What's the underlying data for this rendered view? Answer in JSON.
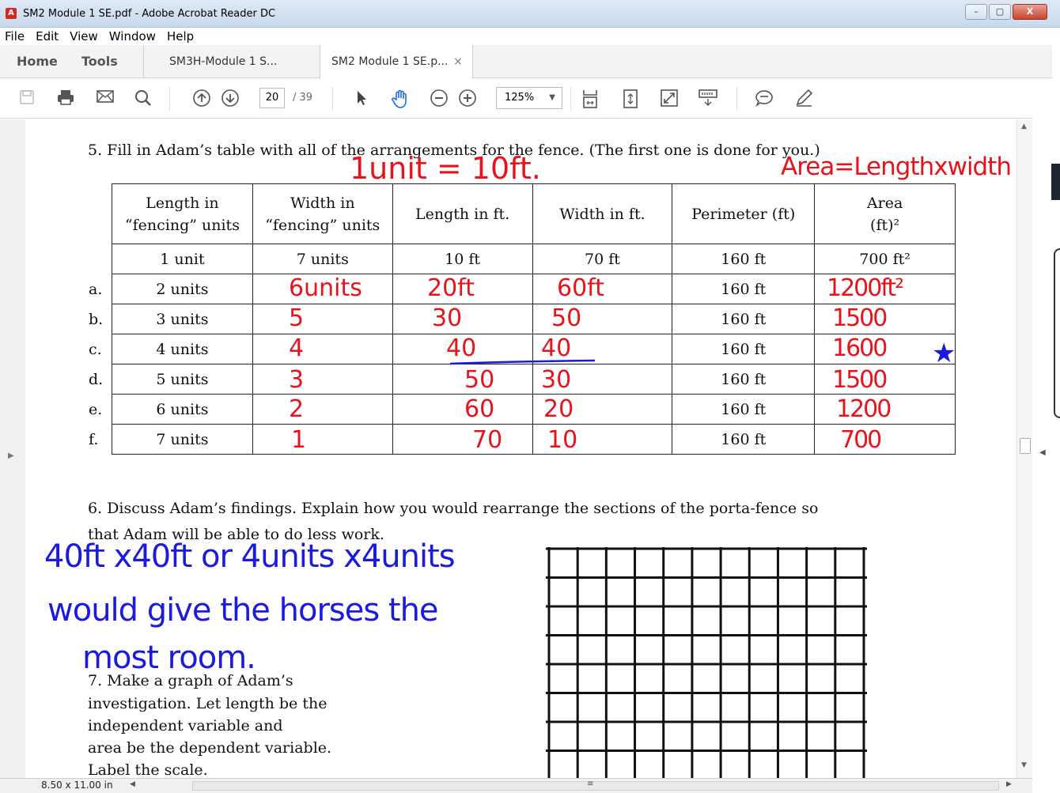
{
  "window": {
    "title": "SM2 Module 1 SE.pdf - Adobe Acrobat Reader DC",
    "controls": {
      "minimize": "–",
      "maximize": "▢",
      "close": "X"
    }
  },
  "menu": [
    "File",
    "Edit",
    "View",
    "Window",
    "Help"
  ],
  "tabs": {
    "home": "Home",
    "tools": "Tools",
    "documents": [
      {
        "label": "SM3H-Module 1 S..."
      },
      {
        "label": "SM2 Module 1 SE.p...",
        "close": "×"
      }
    ]
  },
  "toolbar": {
    "page_current": "20",
    "page_total": "/ 39",
    "zoom": "125%",
    "icons": [
      "save-icon",
      "print-icon",
      "email-icon",
      "search-icon",
      "page-up-icon",
      "page-down-icon",
      "select-arrow-icon",
      "hand-icon",
      "zoom-out-icon",
      "zoom-in-icon",
      "fit-page-icon",
      "scroll-mode-icon",
      "full-screen-icon",
      "read-mode-icon",
      "comment-icon",
      "sign-icon"
    ]
  },
  "document": {
    "q5": "5.  Fill in Adam’s table with all of the arrangements for the fence.  (The first one is done for you.)",
    "table": {
      "headers": [
        "Length in\n“fencing” units",
        "Width in\n“fencing” units",
        "Length in ft.",
        "Width in ft.",
        "Perimeter (ft)",
        "Area\n(ft)²"
      ],
      "example_row": [
        "1 unit",
        "7 units",
        "10 ft",
        "70 ft",
        "160 ft",
        "700 ft²"
      ],
      "rows": [
        {
          "label": "a.",
          "length_units": "2 units",
          "perimeter": "160 ft"
        },
        {
          "label": "b.",
          "length_units": "3 units",
          "perimeter": "160 ft"
        },
        {
          "label": "c.",
          "length_units": "4 units",
          "perimeter": "160 ft"
        },
        {
          "label": "d.",
          "length_units": "5 units",
          "perimeter": "160 ft"
        },
        {
          "label": "e.",
          "length_units": "6 units",
          "perimeter": "160 ft"
        },
        {
          "label": "f.",
          "length_units": "7 units",
          "perimeter": "160 ft"
        }
      ]
    },
    "q6_line1": "6.  Discuss Adam’s findings.  Explain how you would rearrange the sections of the porta-fence so",
    "q6_line2": "that Adam will be able to do less work.",
    "q7_lines": [
      "7.  Make a graph of Adam’s",
      "investigation.  Let length be the",
      " independent variable and",
      "area be the dependent variable.",
      "Label the scale."
    ]
  },
  "handwriting": {
    "unit_note": "1unit = 10ft.",
    "area_note": "Area=Lengthxwidth",
    "width_units": [
      "6units",
      "5",
      "4",
      "3",
      "2",
      "1"
    ],
    "length_ft": [
      "20ft",
      "30",
      "40",
      "50",
      "60",
      "70"
    ],
    "width_ft": [
      "60ft",
      "50",
      "40",
      "30",
      "20",
      "10"
    ],
    "area": [
      "1200ft²",
      "1500",
      "1600",
      "1500",
      "1200",
      "700"
    ],
    "star": "★",
    "answer_line1": "40ft x40ft or 4units x4units",
    "answer_line2": "would give the horses the",
    "answer_line3": "most room."
  },
  "status": {
    "page_size": "8.50 x 11.00 in"
  }
}
